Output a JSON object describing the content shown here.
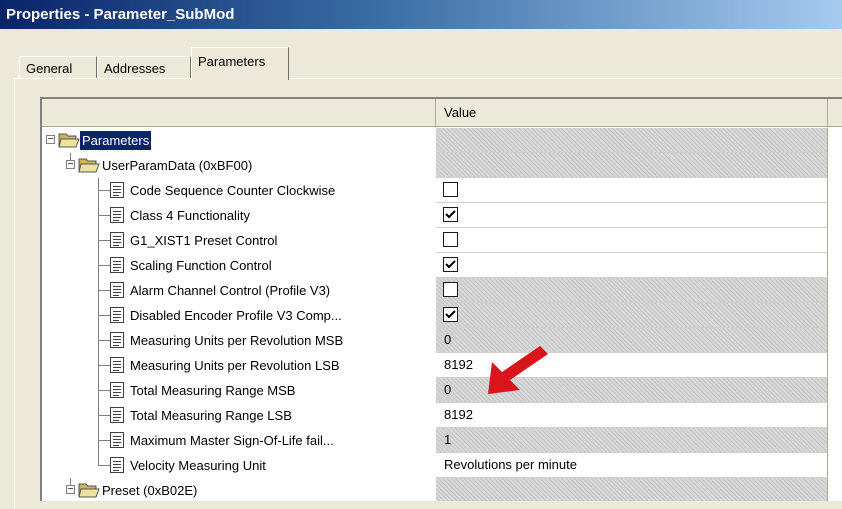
{
  "window": {
    "title": "Properties - Parameter_SubMod"
  },
  "tabs": [
    {
      "label": "General",
      "active": false
    },
    {
      "label": "Addresses",
      "active": false
    },
    {
      "label": "Parameters",
      "active": true
    }
  ],
  "grid": {
    "header": {
      "name_col": "",
      "value_col": "Value"
    },
    "rows": [
      {
        "label": "Parameters",
        "level": 0,
        "kind": "folder",
        "expanded": true,
        "selected": true,
        "value": "",
        "readonly": true
      },
      {
        "label": "UserParamData (0xBF00)",
        "level": 1,
        "kind": "folder",
        "expanded": true,
        "value": "",
        "readonly": true
      },
      {
        "label": "Code Sequence Counter Clockwise",
        "level": 2,
        "kind": "param",
        "value_type": "checkbox",
        "checked": false,
        "readonly": false
      },
      {
        "label": "Class 4 Functionality",
        "level": 2,
        "kind": "param",
        "value_type": "checkbox",
        "checked": true,
        "readonly": false
      },
      {
        "label": "G1_XIST1 Preset Control",
        "level": 2,
        "kind": "param",
        "value_type": "checkbox",
        "checked": false,
        "readonly": false
      },
      {
        "label": "Scaling Function Control",
        "level": 2,
        "kind": "param",
        "value_type": "checkbox",
        "checked": true,
        "readonly": false
      },
      {
        "label": "Alarm Channel Control (Profile V3)",
        "level": 2,
        "kind": "param",
        "value_type": "checkbox",
        "checked": false,
        "readonly": true
      },
      {
        "label": "Disabled Encoder Profile V3 Comp...",
        "level": 2,
        "kind": "param",
        "value_type": "checkbox",
        "checked": true,
        "readonly": true
      },
      {
        "label": "Measuring Units per Revolution MSB",
        "level": 2,
        "kind": "param",
        "value_type": "text",
        "value": "0",
        "readonly": true
      },
      {
        "label": "Measuring Units per Revolution LSB",
        "level": 2,
        "kind": "param",
        "value_type": "text",
        "value": "8192",
        "readonly": false
      },
      {
        "label": "Total Measuring Range MSB",
        "level": 2,
        "kind": "param",
        "value_type": "text",
        "value": "0",
        "readonly": true
      },
      {
        "label": "Total Measuring Range LSB",
        "level": 2,
        "kind": "param",
        "value_type": "text",
        "value": "8192",
        "readonly": false
      },
      {
        "label": "Maximum Master Sign-Of-Life fail...",
        "level": 2,
        "kind": "param",
        "value_type": "text",
        "value": "1",
        "readonly": true
      },
      {
        "label": "Velocity Measuring Unit",
        "level": 2,
        "kind": "param",
        "value_type": "text",
        "value": "Revolutions per minute",
        "readonly": false
      },
      {
        "label": "Preset (0xB02E)",
        "level": 1,
        "kind": "folder",
        "expanded": true,
        "value": "",
        "readonly": true
      }
    ]
  },
  "icons": {
    "folder": "open-folder-icon",
    "param": "parameter-list-icon",
    "expander": "collapse-box-icon",
    "annotation": "red-arrow-icon"
  },
  "colors": {
    "title_bar": "#0a246a",
    "selection": "#0a246a",
    "annotation_arrow": "#d9141b",
    "readonly_cell": "#d8d8d8"
  }
}
